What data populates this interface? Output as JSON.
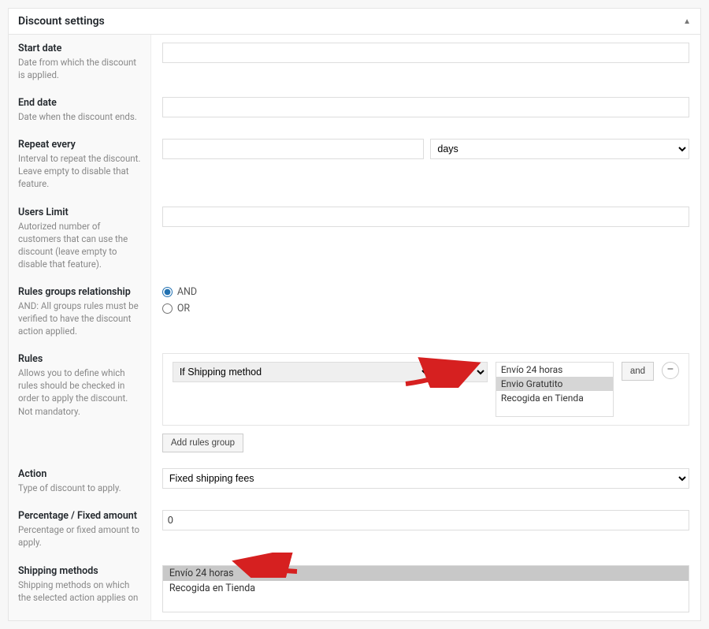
{
  "panel": {
    "title": "Discount settings"
  },
  "fields": {
    "start_date": {
      "label": "Start date",
      "desc": "Date from which the discount is applied.",
      "value": ""
    },
    "end_date": {
      "label": "End date",
      "desc": "Date when the discount ends.",
      "value": ""
    },
    "repeat": {
      "label": "Repeat every",
      "desc": "Interval to repeat the discount. Leave empty to disable that feature.",
      "value": "",
      "unit": "days"
    },
    "users_limit": {
      "label": "Users Limit",
      "desc": "Autorized number of customers that can use the discount (leave empty to disable that feature).",
      "value": ""
    },
    "relationship": {
      "label": "Rules groups relationship",
      "desc": "AND: All groups rules must be verified to have the discount action applied.",
      "and": "AND",
      "or": "OR",
      "selected": "AND"
    },
    "rules": {
      "label": "Rules",
      "desc": "Allows you to define which rules should be checked in order to apply the discount. Not mandatory.",
      "condition": "If Shipping method",
      "operator": "IN",
      "options": [
        "Envío 24 horas",
        "Envio Gratutito",
        "Recogida en Tienda"
      ],
      "selected_option": "Envio Gratutito",
      "and_btn": "and",
      "add_group": "Add rules group"
    },
    "action": {
      "label": "Action",
      "desc": "Type of discount to apply.",
      "value": "Fixed shipping fees"
    },
    "amount": {
      "label": "Percentage / Fixed amount",
      "desc": "Percentage or fixed amount to apply.",
      "value": "0"
    },
    "shipping": {
      "label": "Shipping methods",
      "desc": "Shipping methods on which the selected action applies on",
      "options": [
        "Envío 24 horas",
        "Recogida en Tienda"
      ],
      "selected_option": "Envío 24 horas"
    }
  }
}
